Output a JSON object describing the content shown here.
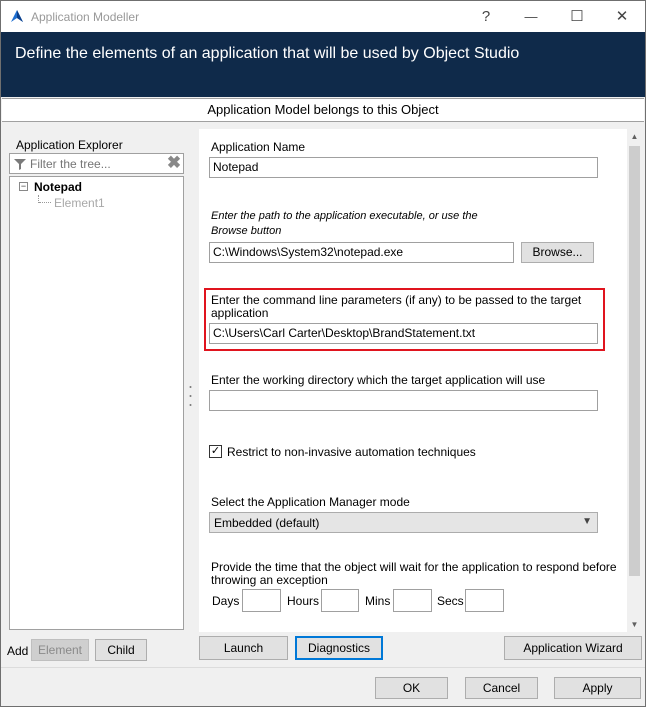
{
  "window": {
    "title": "Application Modeller",
    "help_glyph": "?",
    "minimize_glyph": "—",
    "maximize_glyph": "☐",
    "close_glyph": "✕",
    "app_icon": "blueprism-logo-icon"
  },
  "banner": {
    "text": "Define the elements of an application that will be used by Object Studio",
    "background": "#0f2a4a"
  },
  "belongs_bar": {
    "text": "Application Model belongs to this Object"
  },
  "explorer": {
    "label": "Application Explorer",
    "filter_placeholder": "Filter the tree...",
    "filter_icon": "funnel-icon",
    "clear_glyph": "✖",
    "tree": {
      "expander": "⊟",
      "root": "Notepad",
      "children": [
        "Element1"
      ]
    },
    "add_label": "Add",
    "add_element_button": "Element",
    "add_child_button": "Child"
  },
  "form": {
    "app_name_label": "Application Name",
    "app_name_value": "Notepad",
    "path_label_line1": "Enter the path to the application executable, or use the",
    "path_label_line2": "Browse button",
    "path_value": "C:\\Windows\\System32\\notepad.exe",
    "browse_button": "Browse...",
    "cmdline_label_line1": "Enter the command line parameters (if any) to be passed to the target",
    "cmdline_label_line2": "application",
    "cmdline_value": "C:\\Users\\Carl Carter\\Desktop\\BrandStatement.txt",
    "workdir_label": "Enter the working directory which the target application will use",
    "workdir_value": "",
    "restrict_checked": true,
    "restrict_check_glyph": "✓",
    "restrict_label": "Restrict to non-invasive automation techniques",
    "manager_mode_label": "Select the Application Manager mode",
    "manager_mode_value": "Embedded (default)",
    "dropdown_glyph": "▼",
    "timeout_label_line1": "Provide the time that the object will wait for the application to respond before",
    "timeout_label_line2": "throwing an exception",
    "days_label": "Days",
    "hours_label": "Hours",
    "mins_label": "Mins",
    "secs_label": "Secs",
    "highlight_color": "#e0141e"
  },
  "scrollbar": {
    "up_glyph": "▲",
    "down_glyph": "▼"
  },
  "actions": {
    "launch": "Launch",
    "diagnostics": "Diagnostics",
    "wizard": "Application Wizard"
  },
  "dialog_buttons": {
    "ok": "OK",
    "cancel": "Cancel",
    "apply": "Apply"
  }
}
